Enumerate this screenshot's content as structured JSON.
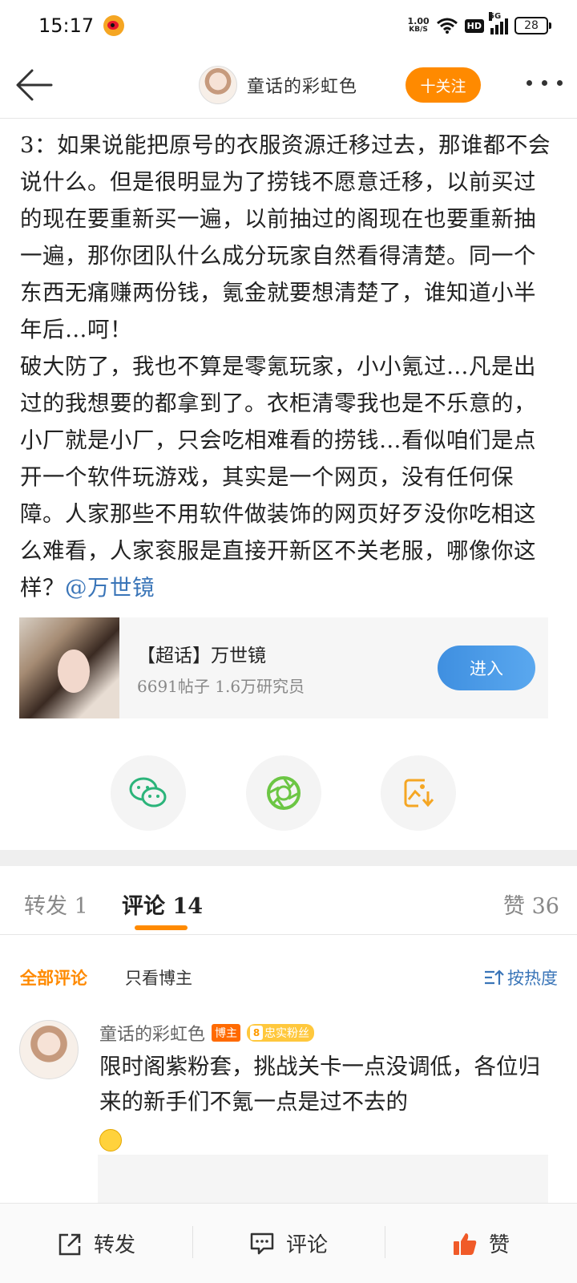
{
  "status": {
    "time": "15:17",
    "net_speed_value": "1.00",
    "net_speed_unit": "KB/S",
    "hd": "HD",
    "network": "5G",
    "battery": "28"
  },
  "nav": {
    "title": "童话的彩虹色",
    "follow_label": "十关注"
  },
  "post": {
    "body": "3：如果说能把原号的衣服资源迁移过去，那谁都不会说什么。但是很明显为了捞钱不愿意迁移，以前买过的现在要重新买一遍，以前抽过的阁现在也要重新抽一遍，那你团队什么成分玩家自然看得清楚。同一个东西无痛赚两份钱，氪金就要想清楚了，谁知道小半年后…呵！\n破大防了，我也不算是零氪玩家，小小氪过…凡是出过的我想要的都拿到了。衣柜清零我也是不乐意的，小厂就是小厂，只会吃相难看的捞钱…看似咱们是点开一个软件玩游戏，其实是一个网页，没有任何保障。人家那些不用软件做装饰的网页好歹没你吃相这么难看，人家衮服是直接开新区不关老服，哪像你这样？",
    "mention": "@万世镜"
  },
  "super_topic": {
    "title": "【超话】万世镜",
    "stats": "6691帖子 1.6万研究员",
    "enter_label": "进入"
  },
  "share": {
    "icons": [
      "wechat-icon",
      "moments-icon",
      "save-image-icon"
    ],
    "colors": [
      "#2bb47a",
      "#6cc644",
      "#f5a623"
    ]
  },
  "tabs": {
    "repost": "转发 1",
    "comment_label": "评论",
    "comment_count": "14",
    "like": "赞 36"
  },
  "filters": {
    "all": "全部评论",
    "op_only": "只看博主",
    "sort": "按热度"
  },
  "comments": [
    {
      "user": "童话的彩虹色",
      "badge_blogger": "博主",
      "fan_level": "8",
      "fan_label": "忠实粉丝",
      "text": "限时阁紫粉套，挑战关卡一点没调低，各位归来的新手们不氪一点是过不去的"
    }
  ],
  "bottom_bar": {
    "repost": "转发",
    "comment": "评论",
    "like": "赞"
  },
  "colors": {
    "accent": "#ff8a00",
    "link": "#3a75b8",
    "enter_button": "#4a9be8"
  }
}
